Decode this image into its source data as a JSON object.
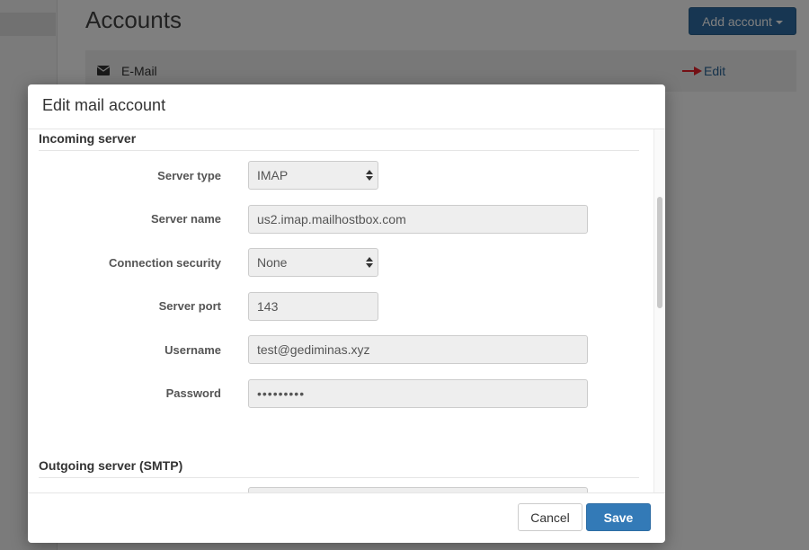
{
  "page": {
    "title": "Accounts",
    "add_account_label": "Add account",
    "accounts": [
      {
        "label": "E-Mail",
        "icon": "envelope-icon",
        "edit_label": "Edit"
      }
    ]
  },
  "modal": {
    "title": "Edit mail account",
    "incoming": {
      "heading": "Incoming server",
      "fields": {
        "server_type": {
          "label": "Server type",
          "value": "IMAP"
        },
        "server_name": {
          "label": "Server name",
          "value": "us2.imap.mailhostbox.com"
        },
        "connection_security": {
          "label": "Connection security",
          "value": "None"
        },
        "server_port": {
          "label": "Server port",
          "value": "143"
        },
        "username": {
          "label": "Username",
          "value": "test@gediminas.xyz"
        },
        "password": {
          "label": "Password",
          "value": "•••••••••"
        }
      }
    },
    "outgoing": {
      "heading": "Outgoing server (SMTP)"
    },
    "footer": {
      "cancel_label": "Cancel",
      "save_label": "Save"
    }
  },
  "colors": {
    "primary": "#337ab7",
    "link": "#2a6496",
    "arrow_annotation": "#e8202a"
  }
}
